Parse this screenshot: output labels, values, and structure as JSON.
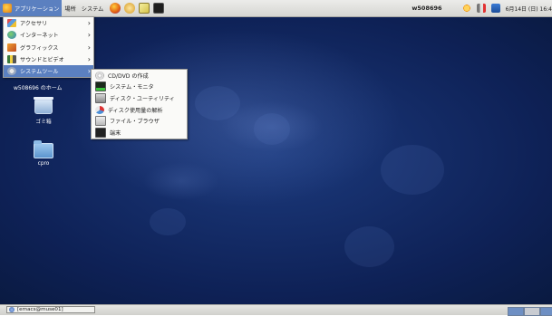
{
  "top_panel": {
    "menus": [
      "アプリケーション",
      "場所",
      "システム"
    ],
    "launchers": [
      "firefox-icon",
      "sound-icon",
      "text-editor-icon",
      "terminal-icon"
    ],
    "hostname": "w508696",
    "clock": "6月14日 (日) 16:4"
  },
  "app_menu": {
    "items": [
      {
        "label": "アクセサリ",
        "icon": "accessories-icon"
      },
      {
        "label": "インターネット",
        "icon": "internet-icon"
      },
      {
        "label": "グラフィックス",
        "icon": "graphics-icon"
      },
      {
        "label": "サウンドとビデオ",
        "icon": "sound-video-icon"
      },
      {
        "label": "システムツール",
        "icon": "system-tools-icon"
      }
    ],
    "highlighted": "システムツール"
  },
  "system_tools_menu": {
    "items": [
      {
        "label": "CD/DVD の作成",
        "icon": "cd-dvd-icon"
      },
      {
        "label": "システム・モニタ",
        "icon": "system-monitor-icon"
      },
      {
        "label": "ディスク・ユーティリティ",
        "icon": "disk-utility-icon"
      },
      {
        "label": "ディスク使用量の解析",
        "icon": "disk-usage-icon"
      },
      {
        "label": "ファイル・ブラウザ",
        "icon": "file-browser-icon"
      },
      {
        "label": "端末",
        "icon": "terminal-icon"
      }
    ]
  },
  "desktop": {
    "home_label": "w508696 のホーム",
    "trash_label": "ゴミ箱",
    "folder_label": "cpro"
  },
  "bottom_panel": {
    "task_label": "[emacs@muse01]"
  },
  "colors": {
    "desktop_bg": "#0e2156",
    "highlight": "#5b80c0",
    "panel_bg": "#e6e6e2"
  }
}
